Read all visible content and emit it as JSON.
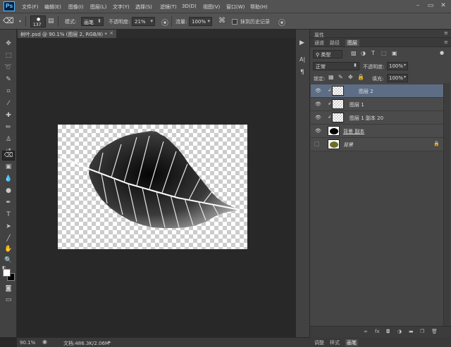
{
  "app": {
    "logo": "Ps"
  },
  "menu": [
    "文件(F)",
    "编辑(E)",
    "图像(I)",
    "图层(L)",
    "文字(Y)",
    "选择(S)",
    "滤镜(T)",
    "3D(D)",
    "视图(V)",
    "窗口(W)",
    "帮助(H)"
  ],
  "window_controls": {
    "minimize": "–",
    "restore": "▭",
    "close": "✕"
  },
  "options": {
    "brush_size": "137",
    "mode_label": "模式:",
    "mode_value": "画笔",
    "opacity_label": "不透明度:",
    "opacity_value": "21%",
    "flow_label": "流量:",
    "flow_value": "100%",
    "history_label": "抹到历史记录"
  },
  "document": {
    "tab_title": "树叶.psd @ 90.1% (图层 2, RGB/8) *",
    "close": "×"
  },
  "status": {
    "zoom": "90.1%",
    "doc_info": "文档:486.3K/2.06M"
  },
  "panel": {
    "properties_tab": "属性",
    "tabs": [
      "通道",
      "路径",
      "图层"
    ],
    "filter_kind": "类型",
    "blend_mode": "正常",
    "opacity_label": "不透明度:",
    "opacity_value": "100%",
    "lock_label": "锁定:",
    "fill_label": "填充:",
    "fill_value": "100%",
    "layers": [
      {
        "name": "图层 2",
        "selected": true
      },
      {
        "name": "图层 1",
        "selected": false
      },
      {
        "name": "图层 1 副本 20",
        "selected": false
      },
      {
        "name": "背景 副本",
        "selected": false
      },
      {
        "name": "背景",
        "selected": false
      }
    ]
  },
  "bottom_tabs": [
    "调整",
    "样式",
    "画笔"
  ],
  "colors": {
    "selection": "#5d6d85",
    "panel": "#454545",
    "chrome": "#535353",
    "canvas_bg": "#282828"
  }
}
